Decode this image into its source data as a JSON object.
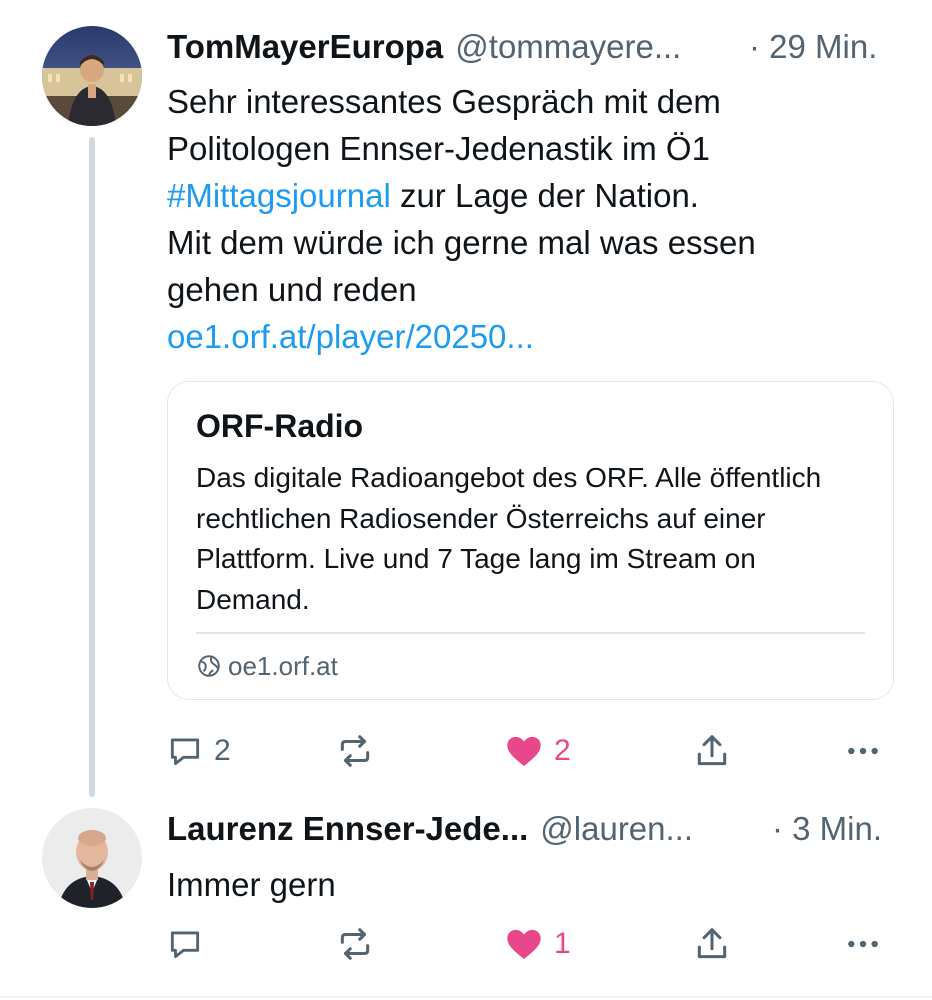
{
  "tweets": [
    {
      "author_name": "TomMayerEuropa",
      "handle": "@tommayere...",
      "time": "· 29 Min.",
      "text_lines": [
        "Sehr interessantes Gespräch mit dem",
        "Politologen Ennser-Jedenastik im Ö1"
      ],
      "hashtag": "#Mittagsjournal",
      "text_after_hashtag": " zur Lage der Nation.",
      "text_lines_2": [
        "Mit dem würde ich gerne mal was essen",
        "gehen und reden"
      ],
      "link": "oe1.orf.at/player/20250...",
      "card": {
        "title": "ORF-Radio",
        "description": "Das digitale Radioangebot des ORF. Alle öffentlich rechtlichen Radiosender Österreichs auf einer Plattform. Live und 7 Tage lang im Stream on Demand.",
        "domain": "oe1.orf.at"
      },
      "replies": "2",
      "retweets": "",
      "likes": "2",
      "liked": true
    },
    {
      "author_name": "Laurenz Ennser-Jede...",
      "handle": "@lauren...",
      "time": "· 3 Min.",
      "text": "Immer gern",
      "replies": "",
      "retweets": "",
      "likes": "1",
      "liked": true
    }
  ],
  "icons": {
    "reply": "speech-bubble-icon",
    "retweet": "retweet-icon",
    "like": "heart-icon",
    "share": "share-icon",
    "more": "more-dots-icon",
    "globe": "globe-icon"
  },
  "colors": {
    "link": "#1d9bf0",
    "like_active": "#e8478b",
    "secondary_text": "#536471",
    "thread_line": "#cfd9de"
  }
}
